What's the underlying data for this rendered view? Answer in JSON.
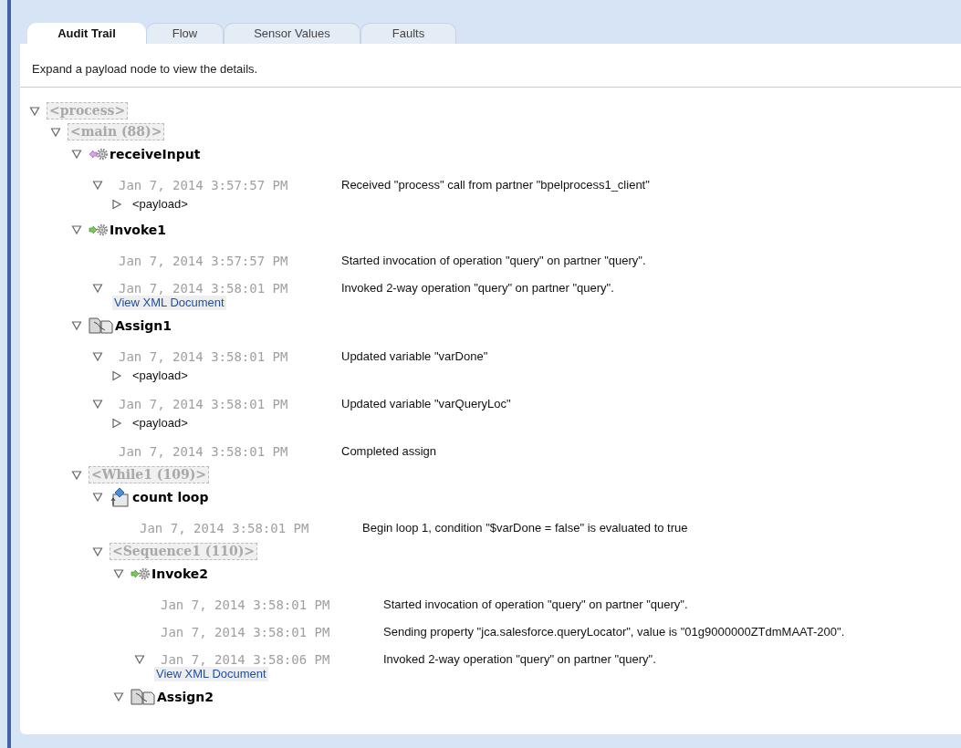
{
  "tabs": [
    {
      "label": "Audit Trail",
      "selected": true
    },
    {
      "label": "Flow",
      "selected": false
    },
    {
      "label": "Sensor Values",
      "selected": false
    },
    {
      "label": "Faults",
      "selected": false
    }
  ],
  "hint": "Expand a payload node to view the details.",
  "tree": [
    {
      "kind": "scope",
      "label": "<process>",
      "expanded": true,
      "children": [
        {
          "kind": "scope",
          "label": "<main (88)>",
          "expanded": true,
          "children": [
            {
              "kind": "receive",
              "label": "receiveInput",
              "expanded": true,
              "children": [
                {
                  "kind": "event",
                  "expanded": true,
                  "date": "Jan 7, 2014 3:57:57 PM",
                  "message": "Received \"process\" call from partner \"bpelprocess1_client\"",
                  "payload": {
                    "label": "<payload>",
                    "expanded": false
                  }
                }
              ]
            },
            {
              "kind": "invoke",
              "label": "Invoke1",
              "expanded": true,
              "children": [
                {
                  "kind": "event",
                  "date": "Jan 7, 2014 3:57:57 PM",
                  "message": "Started invocation of operation \"query\" on partner \"query\"."
                },
                {
                  "kind": "event",
                  "expanded": true,
                  "date": "Jan 7, 2014 3:58:01 PM",
                  "message": "Invoked 2-way operation \"query\" on partner \"query\".",
                  "link": "View XML Document"
                }
              ]
            },
            {
              "kind": "assign",
              "label": "Assign1",
              "expanded": true,
              "children": [
                {
                  "kind": "event",
                  "expanded": true,
                  "date": "Jan 7, 2014 3:58:01 PM",
                  "message": "Updated variable \"varDone\"",
                  "payload": {
                    "label": "<payload>",
                    "expanded": false
                  }
                },
                {
                  "kind": "event",
                  "expanded": true,
                  "date": "Jan 7, 2014 3:58:01 PM",
                  "message": "Updated variable \"varQueryLoc\"",
                  "payload": {
                    "label": "<payload>",
                    "expanded": false
                  }
                },
                {
                  "kind": "event",
                  "date": "Jan 7, 2014 3:58:01 PM",
                  "message": "Completed assign"
                }
              ]
            },
            {
              "kind": "scope",
              "label": "<While1 (109)>",
              "expanded": true,
              "children": [
                {
                  "kind": "loop",
                  "label": "count loop",
                  "expanded": true,
                  "children": [
                    {
                      "kind": "event",
                      "date": "Jan 7, 2014 3:58:01 PM",
                      "message": "Begin loop 1, condition \"$varDone = false\" is evaluated to true"
                    }
                  ]
                },
                {
                  "kind": "scope",
                  "label": "<Sequence1 (110)>",
                  "expanded": true,
                  "children": [
                    {
                      "kind": "invoke",
                      "label": "Invoke2",
                      "expanded": true,
                      "children": [
                        {
                          "kind": "event",
                          "date": "Jan 7, 2014 3:58:01 PM",
                          "message": "Started invocation of operation \"query\" on partner \"query\"."
                        },
                        {
                          "kind": "event",
                          "date": "Jan 7, 2014 3:58:01 PM",
                          "message": "Sending property \"jca.salesforce.queryLocator\", value is \"01g9000000ZTdmMAAT-200\"."
                        },
                        {
                          "kind": "event",
                          "expanded": true,
                          "date": "Jan 7, 2014 3:58:06 PM",
                          "message": "Invoked 2-way operation \"query\" on partner \"query\".",
                          "link": "View XML Document"
                        }
                      ]
                    },
                    {
                      "kind": "assign",
                      "label": "Assign2",
                      "expanded": true
                    }
                  ]
                }
              ]
            }
          ]
        }
      ]
    }
  ]
}
